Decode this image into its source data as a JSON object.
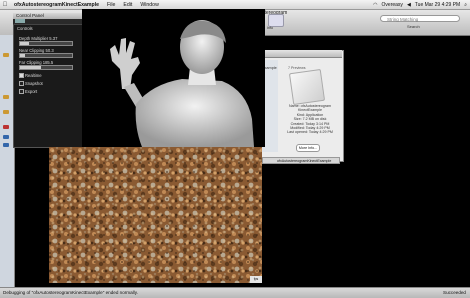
{
  "menubar": {
    "app_name": "ofxAutostereogramKinectExample",
    "menus": [
      "File",
      "Edit",
      "Window"
    ],
    "right_items": [
      "Overeasy",
      "Tue Mar 29  4:29 PM"
    ]
  },
  "xcode": {
    "title_fragment": "stereogram",
    "search_placeholder": "String Matching",
    "search_label": "Search",
    "rect_label": "Info"
  },
  "control_panel": {
    "title": "Control Panel",
    "section": "Controls",
    "sliders": [
      {
        "label": "Depth Multiplier 5.37",
        "value": 0.18
      },
      {
        "label": "Near Clipping 50.3",
        "value": 0.1
      },
      {
        "label": "Far Clipping 185.5",
        "value": 0.4
      }
    ],
    "checkboxes": [
      {
        "label": "Realtime",
        "checked": true
      },
      {
        "label": "Snapshot",
        "checked": false
      },
      {
        "label": "Export",
        "checked": false
      }
    ]
  },
  "info_window": {
    "header_left": "Example",
    "header_right": "7 Previews",
    "lines": [
      "Name: ofxAutostereogram",
      "KinectExample",
      "Kind: Application",
      "Size: 7.2 MB on disk",
      "Created: Today 3:14 PM",
      "Modified: Today 4:29 PM",
      "Last opened: Today 4:29 PM"
    ],
    "more_info_label": "More Info..."
  },
  "window_strip": {
    "label": "ofxAutostereogramKinectExample"
  },
  "stereogram": {
    "corner_label": "fps"
  },
  "statusbar": {
    "left": "Debugging of \"ofxAutostereogramKinectExample\" ended normally.",
    "right": "Succeeded"
  }
}
